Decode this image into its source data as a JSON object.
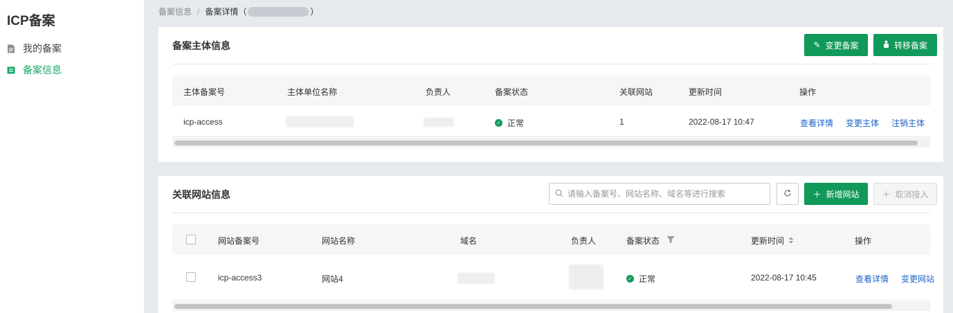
{
  "sidebar": {
    "brand": "ICP备案",
    "items": [
      {
        "label": "我的备案",
        "icon": "document-icon"
      },
      {
        "label": "备案信息",
        "icon": "card-icon"
      }
    ]
  },
  "breadcrumb": {
    "root": "备案信息",
    "separator": "/",
    "current_prefix": "备案详情（",
    "current_suffix": "）"
  },
  "subject": {
    "title": "备案主体信息",
    "buttons": {
      "change": "变更备案",
      "transfer": "转移备案"
    },
    "columns": [
      "主体备案号",
      "主体单位名称",
      "负责人",
      "备案状态",
      "关联网站",
      "更新时间",
      "操作"
    ],
    "rows": [
      {
        "id": "icp-access",
        "status": "正常",
        "sites": "1",
        "updated": "2022-08-17 10:47",
        "actions": [
          "查看详情",
          "变更主体",
          "注销主体"
        ]
      }
    ]
  },
  "sites": {
    "title": "关联网站信息",
    "search_placeholder": "请输入备案号、网站名称、域名等进行搜索",
    "buttons": {
      "add": "新增网站",
      "cancel_access": "取消接入"
    },
    "columns": [
      "网站备案号",
      "网站名称",
      "域名",
      "负责人",
      "备案状态",
      "更新时间",
      "操作"
    ],
    "rows": [
      {
        "id": "icp-access3",
        "name": "网站4",
        "status": "正常",
        "updated": "2022-08-17 10:45",
        "actions": [
          "查看详情",
          "变更网站"
        ]
      }
    ]
  },
  "colors": {
    "accent": "#11995a",
    "active_nav": "#1ba76a",
    "link": "#1c63c9"
  }
}
